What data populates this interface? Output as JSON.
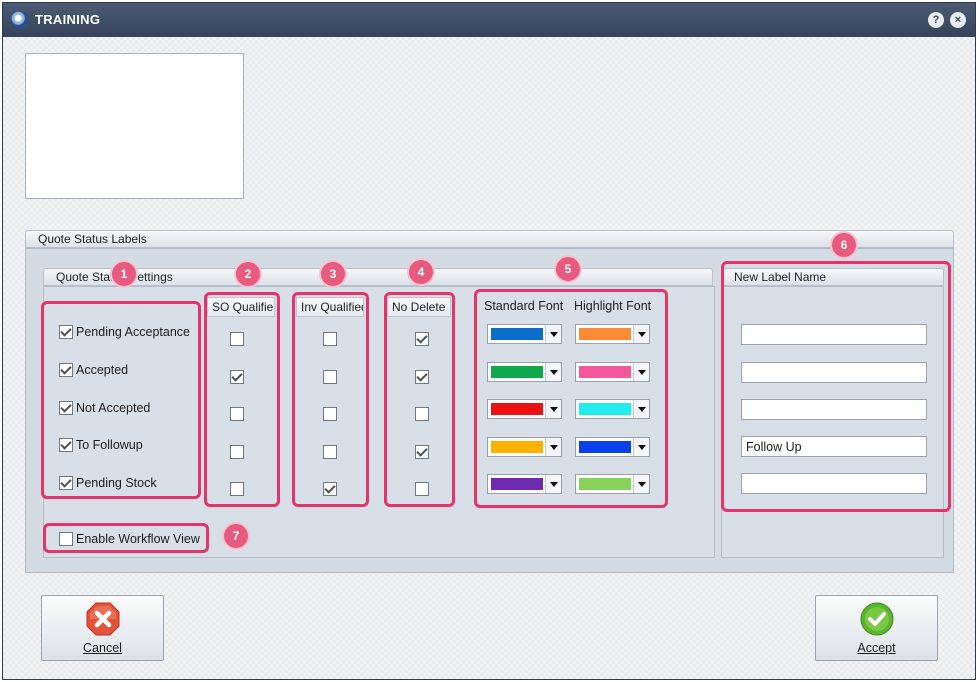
{
  "window": {
    "title": "TRAINING",
    "help_glyph": "?",
    "close_glyph": "×"
  },
  "quote_status_labels": {
    "group_title": "Quote Status Labels",
    "settings_title": "Quote Status Settings",
    "new_label_title": "New Label Name",
    "columns": {
      "so_qualified": "SO Qualified",
      "inv_qualified": "Inv Qualified",
      "no_delete": "No Delete",
      "standard_font": "Standard Font",
      "highlight_font": "Highlight Font"
    },
    "statuses": [
      {
        "label": "Pending Acceptance",
        "enabled": true,
        "so_qualified": false,
        "inv_qualified": false,
        "no_delete": true,
        "standard_color": "#0a6fc8",
        "highlight_color": "#fb8a35",
        "new_label": ""
      },
      {
        "label": "Accepted",
        "enabled": true,
        "so_qualified": true,
        "inv_qualified": false,
        "no_delete": true,
        "standard_color": "#10a84c",
        "highlight_color": "#f2569b",
        "new_label": ""
      },
      {
        "label": "Not Accepted",
        "enabled": true,
        "so_qualified": false,
        "inv_qualified": false,
        "no_delete": false,
        "standard_color": "#ee1111",
        "highlight_color": "#22ecec",
        "new_label": ""
      },
      {
        "label": "To Followup",
        "enabled": true,
        "so_qualified": false,
        "inv_qualified": false,
        "no_delete": true,
        "standard_color": "#fcb300",
        "highlight_color": "#0a40ec",
        "new_label": "Follow Up"
      },
      {
        "label": "Pending Stock",
        "enabled": true,
        "so_qualified": false,
        "inv_qualified": true,
        "no_delete": false,
        "standard_color": "#6f2bb0",
        "highlight_color": "#86d25a",
        "new_label": ""
      }
    ],
    "workflow": {
      "label": "Enable Workflow View",
      "checked": false
    }
  },
  "annotations": [
    "1",
    "2",
    "3",
    "4",
    "5",
    "6",
    "7"
  ],
  "buttons": {
    "cancel": {
      "label": "Cancel",
      "icon": "cancel-icon"
    },
    "accept": {
      "label": "Accept",
      "icon": "accept-icon"
    }
  },
  "colors": {
    "titlebar": "#3e4b62",
    "highlight": "#e5336c",
    "badge": "#e65b7f"
  }
}
